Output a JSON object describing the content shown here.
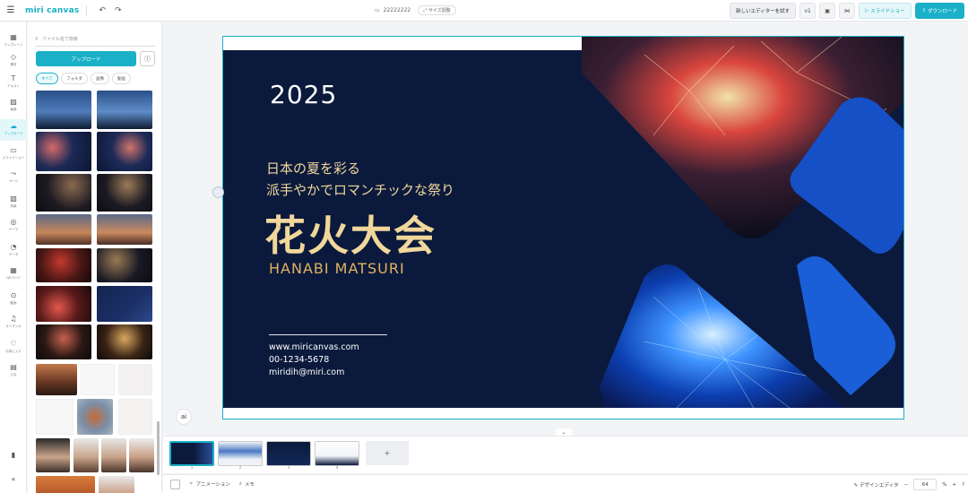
{
  "app": {
    "logo": "miri canvas"
  },
  "topbar": {
    "doc_name": "22222222",
    "resize_label": "サイズ調整",
    "new_editor_label": "新しいエディターを試す",
    "version_label": "v1",
    "slideshow_label": "スライドショー",
    "download_label": "ダウンロード"
  },
  "rail": {
    "items": [
      {
        "label": "テンプレート",
        "icon": "layout-icon"
      },
      {
        "label": "素材",
        "icon": "shapes-icon"
      },
      {
        "label": "テキスト",
        "icon": "text-icon"
      },
      {
        "label": "画像",
        "icon": "image-icon"
      },
      {
        "label": "アップロード",
        "icon": "upload-icon"
      },
      {
        "label": "スライドショー",
        "icon": "slideshow-icon"
      },
      {
        "label": "ページ",
        "icon": "page-icon"
      },
      {
        "label": "背景",
        "icon": "background-icon"
      },
      {
        "label": "テーマ",
        "icon": "theme-icon"
      },
      {
        "label": "データ",
        "icon": "chart-icon"
      },
      {
        "label": "QRコード",
        "icon": "qr-icon"
      },
      {
        "label": "動画",
        "icon": "video-icon"
      },
      {
        "label": "オーディオ",
        "icon": "audio-icon"
      },
      {
        "label": "お気に入り",
        "icon": "heart-icon"
      },
      {
        "label": "ひな",
        "icon": "doc-icon"
      }
    ]
  },
  "panel": {
    "search_placeholder": "ファイル名で検索",
    "upload_label": "アップロード",
    "filters": [
      "すべて",
      "フォルダ",
      "画像",
      "動画"
    ]
  },
  "slide": {
    "year": "2025",
    "line1": "日本の夏を彩る",
    "line2": "派手やかでロマンチックな祭り",
    "title": "花火大会",
    "subtitle": "HANABI MATSURI",
    "contact_web": "www.miricanvas.com",
    "contact_phone": "00-1234-5678",
    "contact_email": "miridih@miri.com"
  },
  "pages": {
    "numbers": [
      "1",
      "2",
      "3",
      "4"
    ],
    "add_label": "+"
  },
  "bottombar": {
    "animation_label": "アニメーション",
    "memo_label": "メモ",
    "design_editor_label": "デザインエディタ",
    "zoom": "64",
    "zoom_unit": "%"
  },
  "colors": {
    "accent": "#1ab0c7",
    "slide_bg": "#0b1a3c",
    "gold": "#f1d79b"
  }
}
